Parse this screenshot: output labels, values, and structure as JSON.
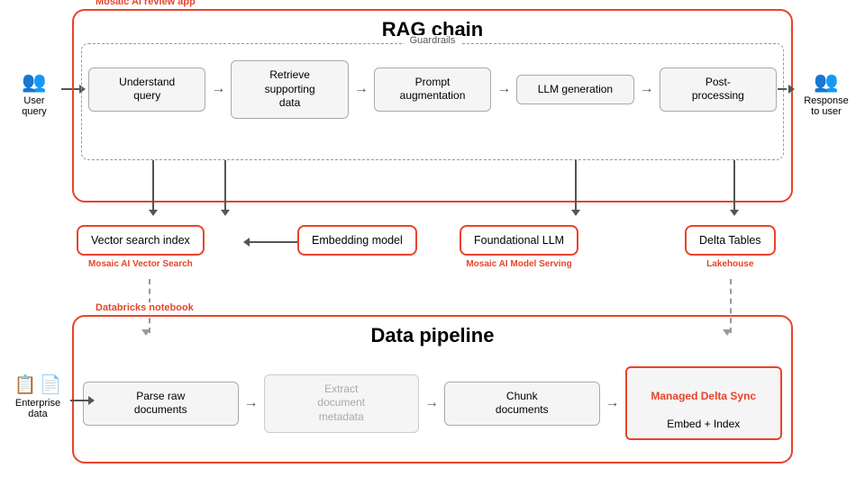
{
  "rag": {
    "outer_label": "Mosaic AI review app",
    "title": "RAG chain",
    "guardrails_label": "Guardrails",
    "processes": [
      {
        "id": "understand",
        "text": "Understand\nquery"
      },
      {
        "id": "retrieve",
        "text": "Retrieve\nsupporting\ndata"
      },
      {
        "id": "prompt",
        "text": "Prompt\naugmentation"
      },
      {
        "id": "llm_gen",
        "text": "LLM\ngeneration"
      },
      {
        "id": "post",
        "text": "Post-\nprocessing"
      }
    ],
    "user_query_label": "User\nquery",
    "response_label": "Response\nto user"
  },
  "lower": {
    "vector_search": {
      "label": "Vector search index",
      "sublabel": "Mosaic AI Vector Search"
    },
    "embedding": {
      "label": "Embedding model"
    },
    "foundational": {
      "label": "Foundational LLM",
      "sublabel": "Mosaic AI Model Serving"
    },
    "delta_tables": {
      "label": "Delta Tables",
      "sublabel": "Lakehouse"
    }
  },
  "pipeline": {
    "notebook_label": "Databricks notebook",
    "title": "Data pipeline",
    "steps": [
      {
        "id": "parse",
        "text": "Parse raw\ndocuments"
      },
      {
        "id": "extract",
        "text": "Extract\ndocument\nmetadata",
        "muted": true
      },
      {
        "id": "chunk",
        "text": "Chunk\ndocuments"
      },
      {
        "id": "managed",
        "text": "Managed Delta Sync\nEmbed + Index",
        "highlight": true
      }
    ],
    "enterprise_label": "Enterprise\ndata"
  }
}
